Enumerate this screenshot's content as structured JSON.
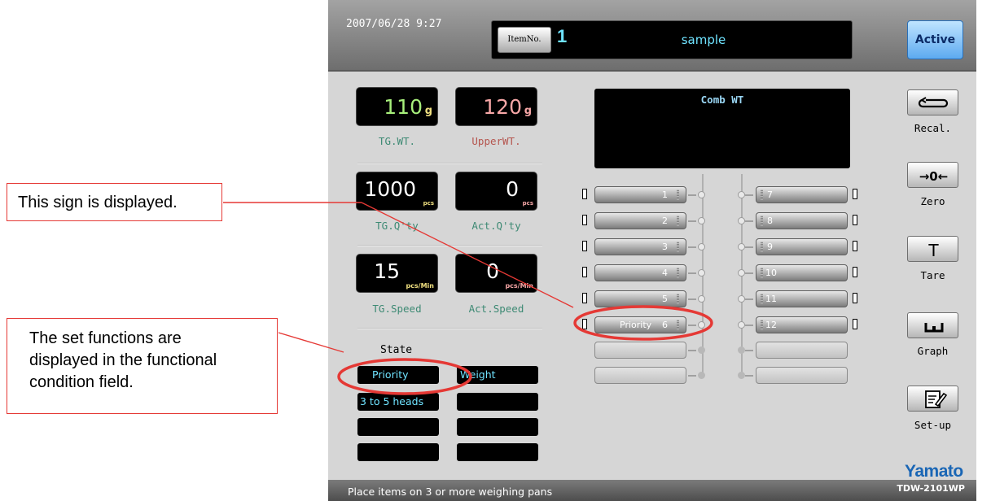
{
  "annotations": {
    "sign_callout": "This sign is displayed.",
    "function_callout": [
      "The set functions are",
      "displayed in the functional",
      "condition field."
    ]
  },
  "header": {
    "datetime": "2007/06/28  9:27",
    "item_no_button": "ItemNo.",
    "item_no": "1",
    "item_name": "sample",
    "active_button": "Active"
  },
  "readings": {
    "tg_wt": {
      "value": "110",
      "unit": "g",
      "label": "TG.WT."
    },
    "upper_wt": {
      "value": "120",
      "unit": "g",
      "label": "UpperWT."
    },
    "tg_qty": {
      "value": "1000",
      "unit": "pcs",
      "label": "TG.Q'ty"
    },
    "act_qty": {
      "value": "0",
      "unit": "pcs",
      "label": "Act.Q'ty"
    },
    "tg_speed": {
      "value": "15",
      "unit": "pcs/Min",
      "label": "TG.Speed"
    },
    "act_speed": {
      "value": "0",
      "unit": "pcs/Min",
      "label": "Act.Speed"
    }
  },
  "state": {
    "label": "State",
    "items": [
      "Priority",
      "Weight",
      "3 to 5 heads",
      "",
      "",
      "",
      "",
      ""
    ]
  },
  "combination": {
    "title": "Comb WT"
  },
  "pans": {
    "left": [
      {
        "num": "1",
        "priority": ""
      },
      {
        "num": "2",
        "priority": ""
      },
      {
        "num": "3",
        "priority": ""
      },
      {
        "num": "4",
        "priority": ""
      },
      {
        "num": "5",
        "priority": ""
      },
      {
        "num": "6",
        "priority": "Priority"
      }
    ],
    "right": [
      {
        "num": "7"
      },
      {
        "num": "8"
      },
      {
        "num": "9"
      },
      {
        "num": "10"
      },
      {
        "num": "11"
      },
      {
        "num": "12"
      }
    ]
  },
  "side_buttons": {
    "recal": "Recal.",
    "zero": "Zero",
    "tare": "Tare",
    "graph": "Graph",
    "setup": "Set-up"
  },
  "brand": "Yamato",
  "footer": {
    "status": "Place items on 3 or more weighing pans",
    "model": "TDW-2101WP"
  },
  "colors": {
    "highlight": "#e53935",
    "display_cyan": "#6fe3ff",
    "label_green": "#3e8a74",
    "brand_blue": "#1a66b5"
  }
}
